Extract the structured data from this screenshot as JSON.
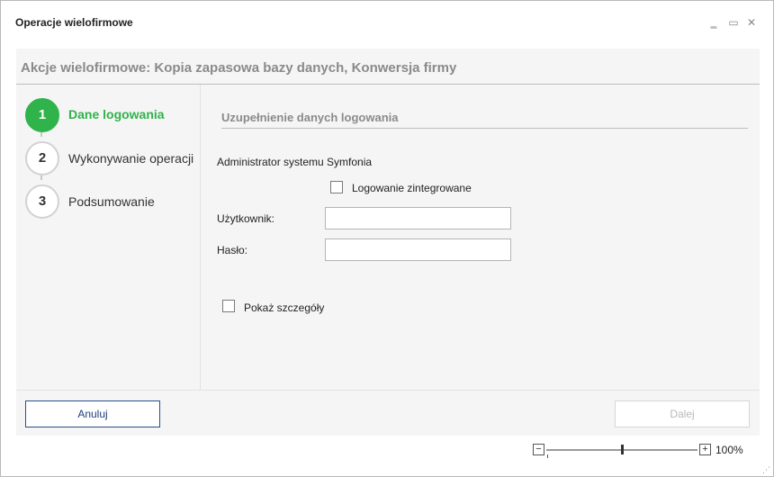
{
  "window": {
    "title": "Operacje wielofirmowe",
    "minimize_icon": "minimize-icon",
    "maximize_icon": "maximize-icon",
    "close_icon": "close-icon"
  },
  "header": {
    "title": "Akcje wielofirmowe: Kopia zapasowa bazy danych, Konwersja firmy"
  },
  "steps": [
    {
      "number": "1",
      "label": "Dane logowania",
      "active": true
    },
    {
      "number": "2",
      "label": "Wykonywanie operacji",
      "active": false
    },
    {
      "number": "3",
      "label": "Podsumowanie",
      "active": false
    }
  ],
  "login": {
    "section_title": "Uzupełnienie danych logowania",
    "admin_label": "Administrator systemu Symfonia",
    "integrated_label": "Logowanie zintegrowane",
    "user_label": "Użytkownik:",
    "user_value": "",
    "password_label": "Hasło:",
    "password_value": "",
    "details_label": "Pokaż szczegóły"
  },
  "footer": {
    "cancel_label": "Anuluj",
    "next_label": "Dalej"
  },
  "zoom": {
    "minus": "−",
    "plus": "+",
    "value": "100%",
    "level_fraction": 0.5
  },
  "colors": {
    "accent_green": "#2fb34a",
    "cancel_border": "#2b4f8c"
  }
}
